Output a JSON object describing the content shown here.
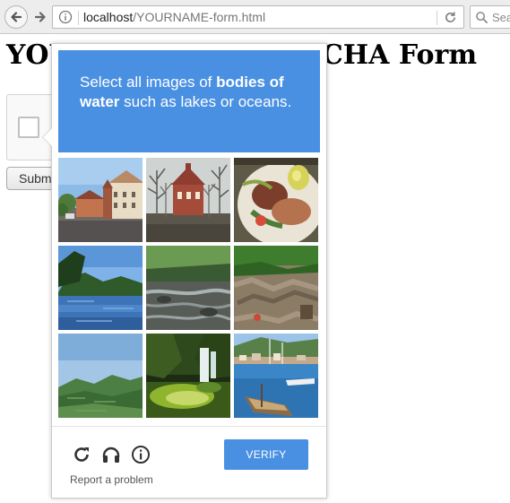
{
  "browser": {
    "url_host": "localhost",
    "url_path": "/YOURNAME-form.html",
    "search_placeholder": "Sea"
  },
  "page": {
    "title": "YOURNAME ReCAPTCHA Form",
    "submit_label": "Submit"
  },
  "challenge": {
    "prompt_prefix": "Select all images of ",
    "prompt_target": "bodies of water",
    "prompt_suffix": " such as lakes or oceans.",
    "tiles": [
      {
        "subject": "town street with church"
      },
      {
        "subject": "brick building with bare trees"
      },
      {
        "subject": "food plate close-up"
      },
      {
        "subject": "river with forested hills"
      },
      {
        "subject": "stream with rocks"
      },
      {
        "subject": "rocky hillside"
      },
      {
        "subject": "green hills and sky"
      },
      {
        "subject": "waterfall in forest"
      },
      {
        "subject": "harbor with boats"
      }
    ],
    "icons": [
      "reload-icon",
      "headphones-icon",
      "info-icon"
    ],
    "report_label": "Report a problem",
    "verify_label": "VERIFY",
    "accent_color": "#4a90e2"
  }
}
